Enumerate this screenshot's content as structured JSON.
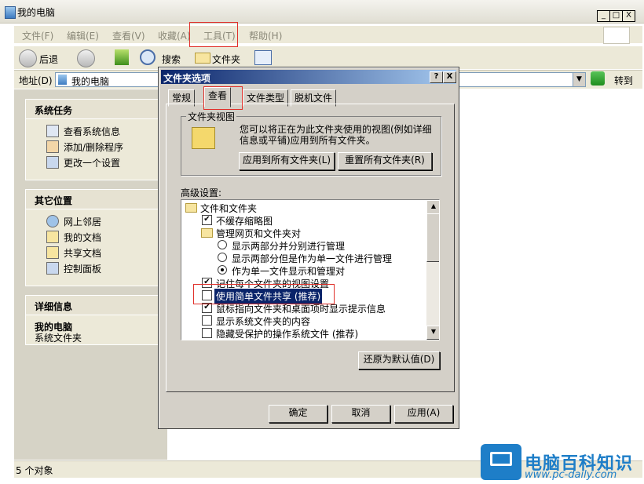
{
  "window": {
    "title": "我的电脑",
    "controls": [
      "_",
      "□",
      "X"
    ]
  },
  "menu": [
    {
      "label": "文件(F)"
    },
    {
      "label": "编辑(E)"
    },
    {
      "label": "查看(V)"
    },
    {
      "label": "收藏(A)"
    },
    {
      "label": "工具(T)"
    },
    {
      "label": "帮助(H)"
    }
  ],
  "toolbar": {
    "back": "后退",
    "search": "搜索",
    "folders": "文件夹"
  },
  "address": {
    "label": "地址(D)",
    "value": "我的电脑",
    "go": "转到"
  },
  "left_pane": {
    "system_tasks": {
      "title": "系统任务",
      "items": [
        "查看系统信息",
        "添加/删除程序",
        "更改一个设置"
      ]
    },
    "other_places": {
      "title": "其它位置",
      "items": [
        "网上邻居",
        "我的文档",
        "共享文档",
        "控制面板"
      ]
    },
    "details": {
      "title": "详细信息",
      "name": "我的电脑",
      "desc": "系统文件夹"
    }
  },
  "status": {
    "text": "5 个对象"
  },
  "dialog": {
    "title": "文件夹选项",
    "help": "?",
    "close": "X",
    "tabs": [
      "常规",
      "查看",
      "文件类型",
      "脱机文件"
    ],
    "active_tab": "查看",
    "folder_views": {
      "title": "文件夹视图",
      "description": "您可以将正在为此文件夹使用的视图(例如详细信息或平铺)应用到所有文件夹。",
      "apply_all": "应用到所有文件夹(L)",
      "reset_all": "重置所有文件夹(R)"
    },
    "advanced_label": "高级设置:",
    "settings": [
      {
        "type": "folder",
        "label": "文件和文件夹",
        "indent": 0
      },
      {
        "type": "check",
        "label": "不缓存缩略图",
        "checked": true,
        "indent": 1
      },
      {
        "type": "folder",
        "label": "管理网页和文件夹对",
        "indent": 1
      },
      {
        "type": "radio",
        "label": "显示两部分并分别进行管理",
        "checked": false,
        "indent": 2
      },
      {
        "type": "radio",
        "label": "显示两部分但是作为单一文件进行管理",
        "checked": false,
        "indent": 2
      },
      {
        "type": "radio",
        "label": "作为单一文件显示和管理对",
        "checked": true,
        "indent": 2
      },
      {
        "type": "check",
        "label": "记住每个文件夹的视图设置",
        "checked": true,
        "indent": 1
      },
      {
        "type": "check",
        "label": "使用简单文件共享 (推荐)",
        "checked": false,
        "indent": 1,
        "selected": true
      },
      {
        "type": "check",
        "label": "鼠标指向文件夹和桌面项时显示提示信息",
        "checked": true,
        "indent": 1
      },
      {
        "type": "check",
        "label": "显示系统文件夹的内容",
        "checked": false,
        "indent": 1
      },
      {
        "type": "check",
        "label": "隐藏受保护的操作系统文件 (推荐)",
        "checked": false,
        "indent": 1
      }
    ],
    "restore_defaults": "还原为默认值(D)",
    "ok": "确定",
    "cancel": "取消",
    "apply": "应用(A)"
  },
  "watermark": {
    "title": "电脑百科知识",
    "url": "www.pc-daily.com"
  },
  "colors": {
    "dialog_title_start": "#0a246a",
    "dialog_title_end": "#a6caf0",
    "highlight": "#0a246a",
    "annotation": "#e0302a",
    "watermark": "#1e7ec8"
  }
}
